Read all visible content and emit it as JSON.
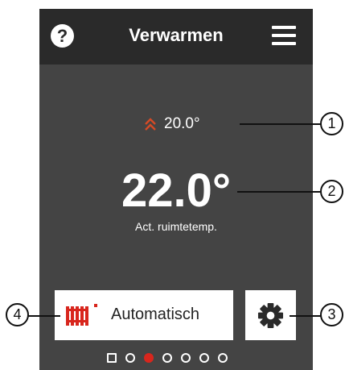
{
  "header": {
    "title": "Verwarmen",
    "help_icon": "question-circle-icon",
    "help_glyph": "?",
    "menu_icon": "hamburger-menu-icon"
  },
  "setpoint": {
    "icon": "double-chevron-up-icon",
    "value": "20.0°"
  },
  "room": {
    "temperature": "22.0°",
    "label": "Act. ruimtetemp."
  },
  "controls": {
    "mode_icon": "radiator-icon",
    "mode_label": "Automatisch",
    "settings_icon": "gear-icon"
  },
  "pagination": {
    "count": 7,
    "active_index": 2
  },
  "callouts": [
    "1",
    "2",
    "3",
    "4"
  ],
  "colors": {
    "header_bg": "#2a2a2a",
    "screen_bg": "#444444",
    "accent_red": "#d8261d",
    "setpoint_arrow": "#d64a26",
    "text": "#ffffff"
  }
}
